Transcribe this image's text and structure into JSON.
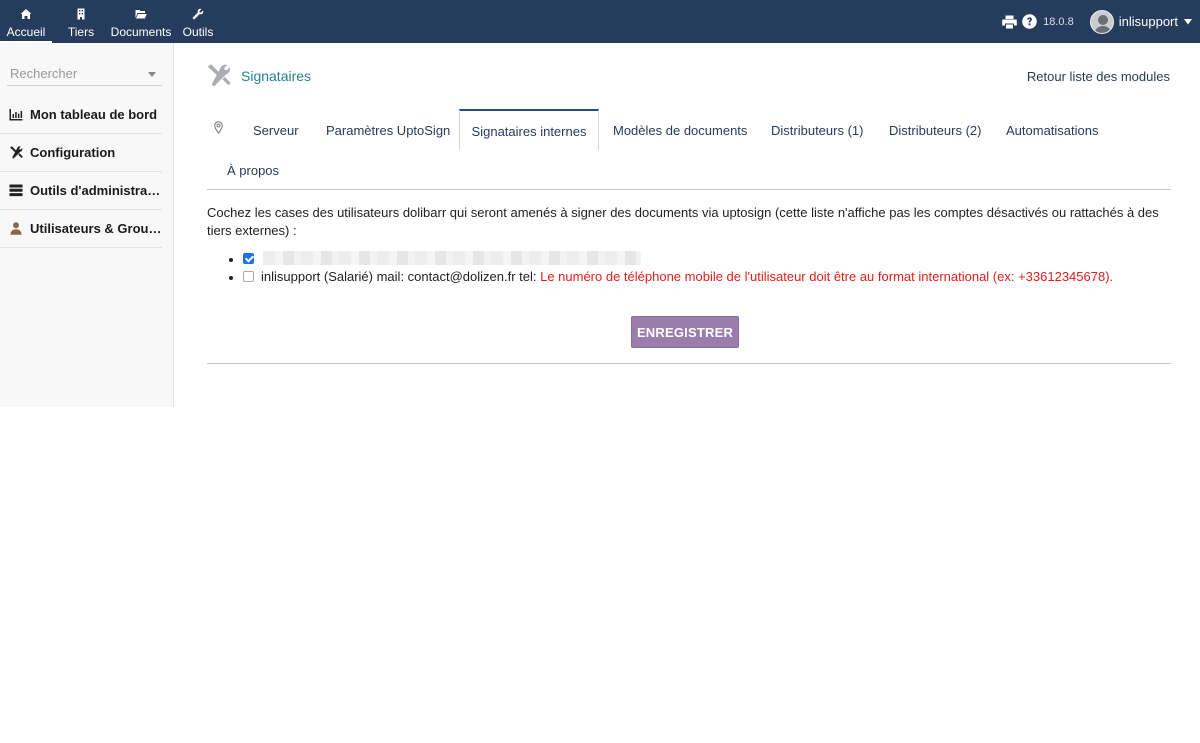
{
  "topbar": {
    "menu": [
      {
        "label": "Accueil",
        "icon": "home-icon",
        "active": true
      },
      {
        "label": "Tiers",
        "icon": "building-icon"
      },
      {
        "label": "Documents",
        "icon": "folder-open-icon"
      },
      {
        "label": "Outils",
        "icon": "wrench-icon"
      }
    ],
    "version": "18.0.8",
    "username": "inlisupport"
  },
  "sidebar": {
    "search_placeholder": "Rechercher",
    "items": [
      {
        "label": "Mon tableau de bord",
        "icon": "chart-icon"
      },
      {
        "label": "Configuration",
        "icon": "tools-icon"
      },
      {
        "label": "Outils d'administration",
        "icon": "server-icon"
      },
      {
        "label": "Utilisateurs & Groupes",
        "icon": "user-icon"
      }
    ]
  },
  "header": {
    "title": "Signataires",
    "back_link": "Retour liste des modules"
  },
  "tabs": [
    {
      "label": "Serveur"
    },
    {
      "label": "Paramètres UptoSign"
    },
    {
      "label": "Signataires internes",
      "active": true
    },
    {
      "label": "Modèles de documents"
    },
    {
      "label": "Distributeurs (1)"
    },
    {
      "label": "Distributeurs (2)"
    },
    {
      "label": "Automatisations"
    },
    {
      "label": "À propos"
    }
  ],
  "main": {
    "intro": "Cochez les cases des utilisateurs dolibarr qui seront amenés à signer des documents via uptosign (cette liste n'affiche pas les comptes désactivés ou rattachés à des tiers externes) :",
    "users": [
      {
        "checked": true,
        "redacted": true
      },
      {
        "checked": false,
        "text": "inlisupport (Salarié) mail: contact@dolizen.fr tel: ",
        "error": "Le numéro de téléphone mobile de l'utilisateur doit être au format international (ex: +33612345678)."
      }
    ],
    "save_label": "ENREGISTRER"
  },
  "colors": {
    "topbar": "#263c5c",
    "title": "#2a7f8f",
    "button": "#9b7dac",
    "error": "#e0201a"
  }
}
